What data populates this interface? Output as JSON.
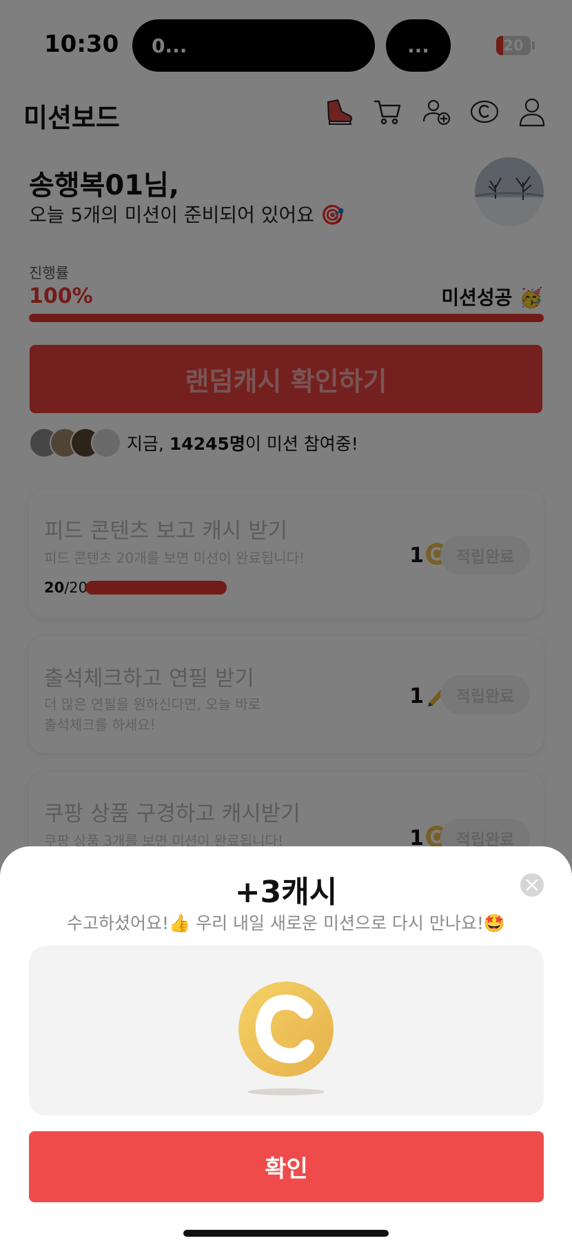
{
  "status_bar": {
    "time": "10:30",
    "island_left": "0...",
    "island_right": "...",
    "battery_level": "20",
    "battery_fraction": 0.2,
    "wifi_icon": "wifi-icon"
  },
  "header": {
    "title": "미션보드",
    "icons": [
      "sneaker-icon",
      "cart-icon",
      "add-friend-icon",
      "cash-icon",
      "profile-icon"
    ]
  },
  "greeting": {
    "name": "송행복01님,",
    "subtitle": "오늘 5개의 미션이 준비되어 있어요 🎯"
  },
  "progress": {
    "label": "진행률",
    "value_text": "100%",
    "fraction": 1.0,
    "status": "미션성공 🥳"
  },
  "random_cash_button": "랜덤캐시 확인하기",
  "participants": {
    "prefix": "지금, ",
    "count": "14245명",
    "suffix": "이 미션 참여중!"
  },
  "missions": [
    {
      "title": "피드 콘텐츠 보고 캐시 받기",
      "desc": "피드 콘텐츠 20개를 보면 미션이 완료됩니다!",
      "count_done": "20",
      "count_total": "/20",
      "fraction": 1.0,
      "reward": "1",
      "reward_icon": "cash-coin-icon",
      "button": "적립완료"
    },
    {
      "title": "출석체크하고 연필 받기",
      "desc_line1": "더 많은 연필을 원하신다면, 오늘 바로",
      "desc_line2": "출석체크를 하세요!",
      "reward": "1",
      "reward_icon": "pencil-icon",
      "button": "적립완료"
    },
    {
      "title": "쿠팡 상품 구경하고 캐시받기",
      "desc": "쿠팡 상품 3개를 보면 미션이 완료됩니다!",
      "reward": "1",
      "reward_icon": "cash-coin-icon",
      "button": "적립완료"
    }
  ],
  "sheet": {
    "title": "+3캐시",
    "subtitle": "수고하셨어요!👍 우리 내일 새로운 미션으로 다시 만나요!🤩",
    "close_icon": "close-icon",
    "coin_icon": "cash-coin-icon",
    "confirm": "확인"
  },
  "colors": {
    "accent": "#e53935",
    "button_red": "#ef4b4b",
    "coin_gold": "#edc04f"
  }
}
